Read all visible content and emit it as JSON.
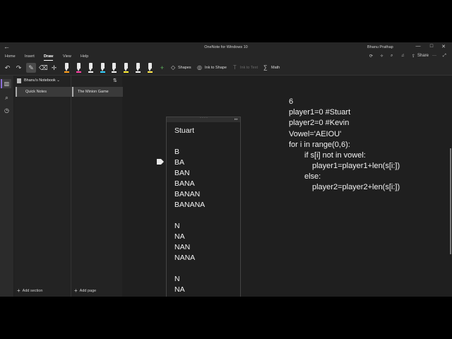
{
  "window": {
    "title": "OneNote for Windows 10",
    "user": "Bhanu Prathap",
    "back_glyph": "←",
    "minimize_glyph": "—",
    "maximize_glyph": "□",
    "close_glyph": "✕"
  },
  "ribbon": {
    "tabs": [
      "Home",
      "Insert",
      "Draw",
      "View",
      "Help"
    ],
    "active_tab": "Draw",
    "share_label": "Share"
  },
  "toolbar": {
    "undo_icon": "undo-icon",
    "redo_icon": "redo-icon",
    "pens": [
      {
        "color": "#ff9f1a"
      },
      {
        "color": "#ff3fa4"
      },
      {
        "color": "#f0f0f0"
      },
      {
        "color": "#33d1ff"
      },
      {
        "color": "#f0f0f0"
      },
      {
        "color": "#ffee33"
      },
      {
        "color": "#f0f0f0"
      },
      {
        "color": "#ffe94d"
      },
      {
        "color": "#4a8cff"
      }
    ],
    "shapes_label": "Shapes",
    "ink_to_shape_label": "Ink to Shape",
    "ink_to_text_label": "Ink to Text",
    "math_label": "Math"
  },
  "navigation": {
    "notebook_name": "Bhanu's Notebook",
    "sections": [
      {
        "label": "Quick Notes"
      }
    ],
    "pages": [
      {
        "label": "The Minion Game"
      }
    ],
    "add_section_label": "Add section",
    "add_page_label": "Add page"
  },
  "note_lines": [
    "Stuart",
    "B",
    "BA",
    "BAN",
    "BANA",
    "BANAN",
    "BANANA",
    "N",
    "NA",
    "NAN",
    "NANA",
    "N",
    "NA"
  ],
  "code_lines": [
    "6",
    "player1=0 #Stuart",
    "player2=0 #Kevin",
    "Vowel='AEIOU'",
    "for i in range(0,6):",
    "if s[i] not in vowel:",
    "player1=player1+len(s[i:])",
    "else:",
    "player2=player2+len(s[i:])"
  ],
  "colors": {
    "accent": "#8c6fd6",
    "background": "#1f1f1f"
  }
}
